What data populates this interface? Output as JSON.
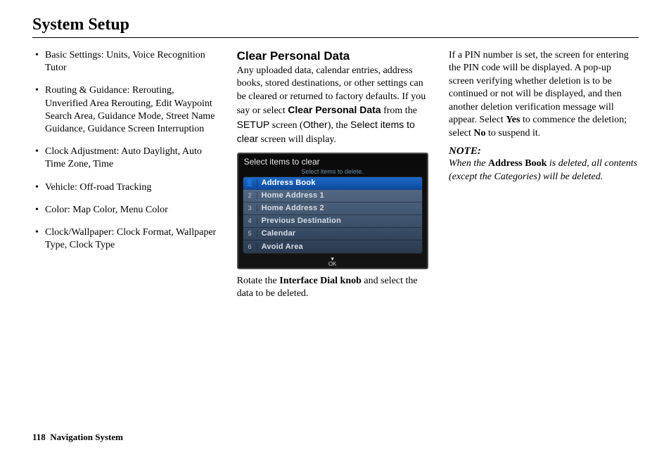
{
  "page_title": "System Setup",
  "bullets": [
    "Basic Settings: Units, Voice Recognition Tutor",
    "Routing & Guidance: Rerouting, Unverified Area Rerouting, Edit Waypoint Search Area, Guidance Mode, Street Name Guidance, Guidance Screen Interruption",
    "Clock Adjustment: Auto Daylight, Auto Time Zone, Time",
    "Vehicle: Off-road Tracking",
    "Color: Map Color, Menu Color",
    "Clock/Wallpaper: Clock Format, Wallpaper Type, Clock Type"
  ],
  "section_title": "Clear Personal Data",
  "col2": {
    "p1_a": "Any uploaded data, calendar entries, address books, stored destinations, or other settings can be cleared or returned to factory defaults. If you say or select ",
    "p1_b": "Clear Personal Data",
    "p1_c": " from the ",
    "p1_d": "SETUP",
    "p1_e": " screen (",
    "p1_f": "Other",
    "p1_g": "), the ",
    "p1_h": "Select items to clear",
    "p1_i": " screen will display.",
    "p2_a": "Rotate the ",
    "p2_b": "Interface Dial knob",
    "p2_c": " and select the data to be deleted."
  },
  "device": {
    "title": "Select items to clear",
    "subtitle": "Select items to delete.",
    "rows": [
      {
        "num": "",
        "icon": "👤",
        "label": "Address Book",
        "selected": true
      },
      {
        "num": "2",
        "label": "Home Address 1"
      },
      {
        "num": "3",
        "label": "Home Address 2"
      },
      {
        "num": "4",
        "label": "Previous Destination"
      },
      {
        "num": "5",
        "label": "Calendar"
      },
      {
        "num": "6",
        "label": "Avoid Area"
      }
    ],
    "ok": "OK"
  },
  "col3": {
    "p1_a": "If a PIN number is set, the screen for entering the PIN code will be displayed. A pop-up screen verifying whether deletion is to be continued or not will be displayed, and then another deletion verification message will appear. Select ",
    "p1_b": "Yes",
    "p1_c": " to commence the deletion; select ",
    "p1_d": "No",
    "p1_e": " to suspend it.",
    "note_head": "NOTE:",
    "note_a": "When the ",
    "note_b": "Address Book",
    "note_c": " is deleted, all contents (except the Categories) will be deleted."
  },
  "footer": {
    "page": "118",
    "label": "Navigation System"
  }
}
